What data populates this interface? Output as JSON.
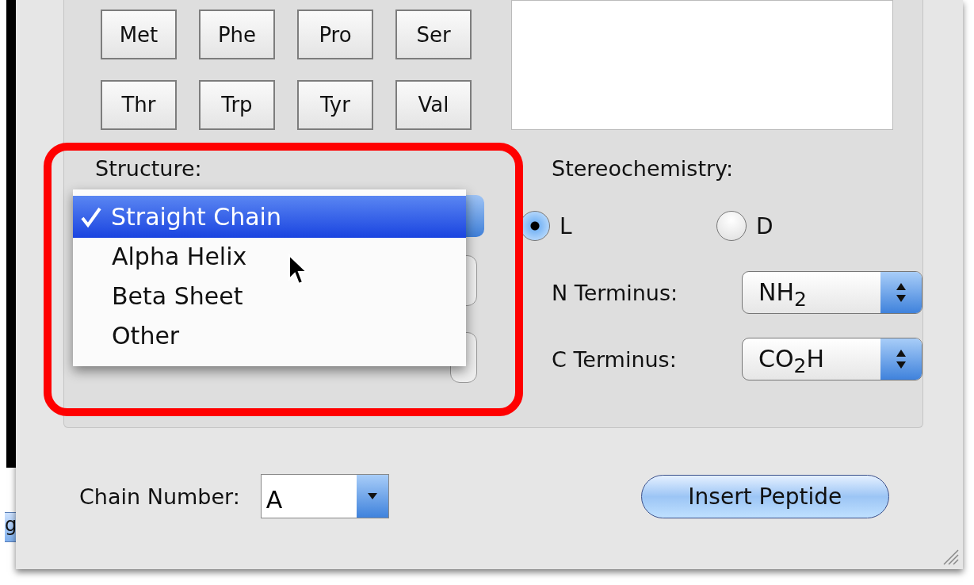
{
  "amino_buttons": [
    "Met",
    "Phe",
    "Pro",
    "Ser",
    "Thr",
    "Trp",
    "Tyr",
    "Val"
  ],
  "structure": {
    "label": "Structure:",
    "menu": [
      {
        "label": "Straight Chain",
        "selected": true
      },
      {
        "label": "Alpha Helix",
        "selected": false
      },
      {
        "label": "Beta Sheet",
        "selected": false
      },
      {
        "label": "Other",
        "selected": false
      }
    ]
  },
  "stereochemistry": {
    "label": "Stereochemistry:",
    "options": [
      {
        "label": "L",
        "selected": true
      },
      {
        "label": "D",
        "selected": false
      }
    ]
  },
  "termini": [
    {
      "label": "N Terminus:",
      "value": "NH$_{2}$"
    },
    {
      "label": "C Terminus:",
      "value": "CO$_{2}$H"
    }
  ],
  "chain_number": {
    "label": "Chain Number:",
    "value": "A"
  },
  "insert_button": "Insert Peptide",
  "background_fragment": "g"
}
